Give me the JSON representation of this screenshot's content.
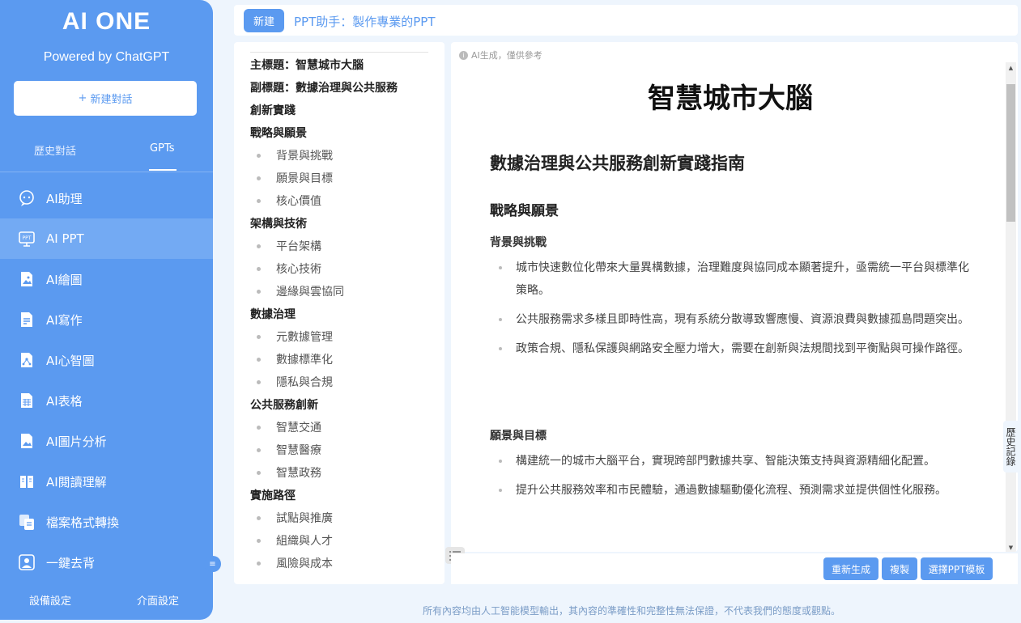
{
  "sidebar": {
    "logo": "AI ONE",
    "subtitle": "Powered by ChatGPT",
    "new_chat_label": "新建對話",
    "tabs": {
      "history": "歷史對話",
      "gpts": "GPTs"
    },
    "items": [
      {
        "label": "AI助理",
        "icon": "assistant-icon"
      },
      {
        "label": "AI PPT",
        "icon": "ppt-icon",
        "active": true
      },
      {
        "label": "AI繪圖",
        "icon": "image-icon"
      },
      {
        "label": "AI寫作",
        "icon": "writing-icon"
      },
      {
        "label": "AI心智圖",
        "icon": "mindmap-icon"
      },
      {
        "label": "AI表格",
        "icon": "table-icon"
      },
      {
        "label": "AI圖片分析",
        "icon": "image-analysis-icon"
      },
      {
        "label": "AI閱讀理解",
        "icon": "reading-icon"
      },
      {
        "label": "檔案格式轉換",
        "icon": "file-convert-icon"
      },
      {
        "label": "一鍵去背",
        "icon": "remove-bg-icon"
      }
    ],
    "footer": {
      "device_settings": "設備設定",
      "ui_settings": "介面設定"
    }
  },
  "topbar": {
    "new_label": "新建",
    "title": "PPT助手：製作專業的PPT"
  },
  "outline": [
    {
      "level": 1,
      "label": "主標題：智慧城市大腦"
    },
    {
      "level": 1,
      "label": "副標題：數據治理與公共服務"
    },
    {
      "level": 1,
      "label": "創新實踐"
    },
    {
      "level": 1,
      "label": "戰略與願景"
    },
    {
      "level": 2,
      "label": "背景與挑戰"
    },
    {
      "level": 2,
      "label": "願景與目標"
    },
    {
      "level": 2,
      "label": "核心價值"
    },
    {
      "level": 1,
      "label": "架構與技術"
    },
    {
      "level": 2,
      "label": "平台架構"
    },
    {
      "level": 2,
      "label": "核心技術"
    },
    {
      "level": 2,
      "label": "邊緣與雲協同"
    },
    {
      "level": 1,
      "label": "數據治理"
    },
    {
      "level": 2,
      "label": "元數據管理"
    },
    {
      "level": 2,
      "label": "數據標準化"
    },
    {
      "level": 2,
      "label": "隱私與合規"
    },
    {
      "level": 1,
      "label": "公共服務創新"
    },
    {
      "level": 2,
      "label": "智慧交通"
    },
    {
      "level": 2,
      "label": "智慧醫療"
    },
    {
      "level": 2,
      "label": "智慧政務"
    },
    {
      "level": 1,
      "label": "實施路徑"
    },
    {
      "level": 2,
      "label": "試點與推廣"
    },
    {
      "level": 2,
      "label": "組織與人才"
    },
    {
      "level": 2,
      "label": "風險與成本"
    }
  ],
  "preview": {
    "ai_note": "AI生成，僅供參考",
    "title": "智慧城市大腦",
    "subtitle": "數據治理與公共服務創新實踐指南",
    "section": "戰略與願景",
    "sub1": "背景與挑戰",
    "sub1_bullets": [
      "城市快速數位化帶來大量異構數據，治理難度與協同成本顯著提升，亟需統一平台與標準化策略。",
      "公共服務需求多樣且即時性高，現有系統分散導致響應慢、資源浪費與數據孤島問題突出。",
      "政策合規、隱私保護與網路安全壓力增大，需要在創新與法規間找到平衡點與可操作路徑。"
    ],
    "sub2": "願景與目標",
    "sub2_bullets": [
      "構建統一的城市大腦平台，實現跨部門數據共享、智能決策支持與資源精細化配置。",
      "提升公共服務效率和市民體驗，通過數據驅動優化流程、預測需求並提供個性化服務。"
    ]
  },
  "history_tab": "歷史記錄",
  "actions": {
    "regenerate": "重新生成",
    "copy": "複製",
    "choose_template": "選擇PPT模板"
  },
  "disclaimer": "所有內容均由人工智能模型輸出，其內容的準確性和完整性無法保證，不代表我們的態度或觀點。",
  "colors": {
    "accent": "#5b9af0",
    "sidebar_active": "#73aaf3",
    "background": "#eef5fd"
  }
}
